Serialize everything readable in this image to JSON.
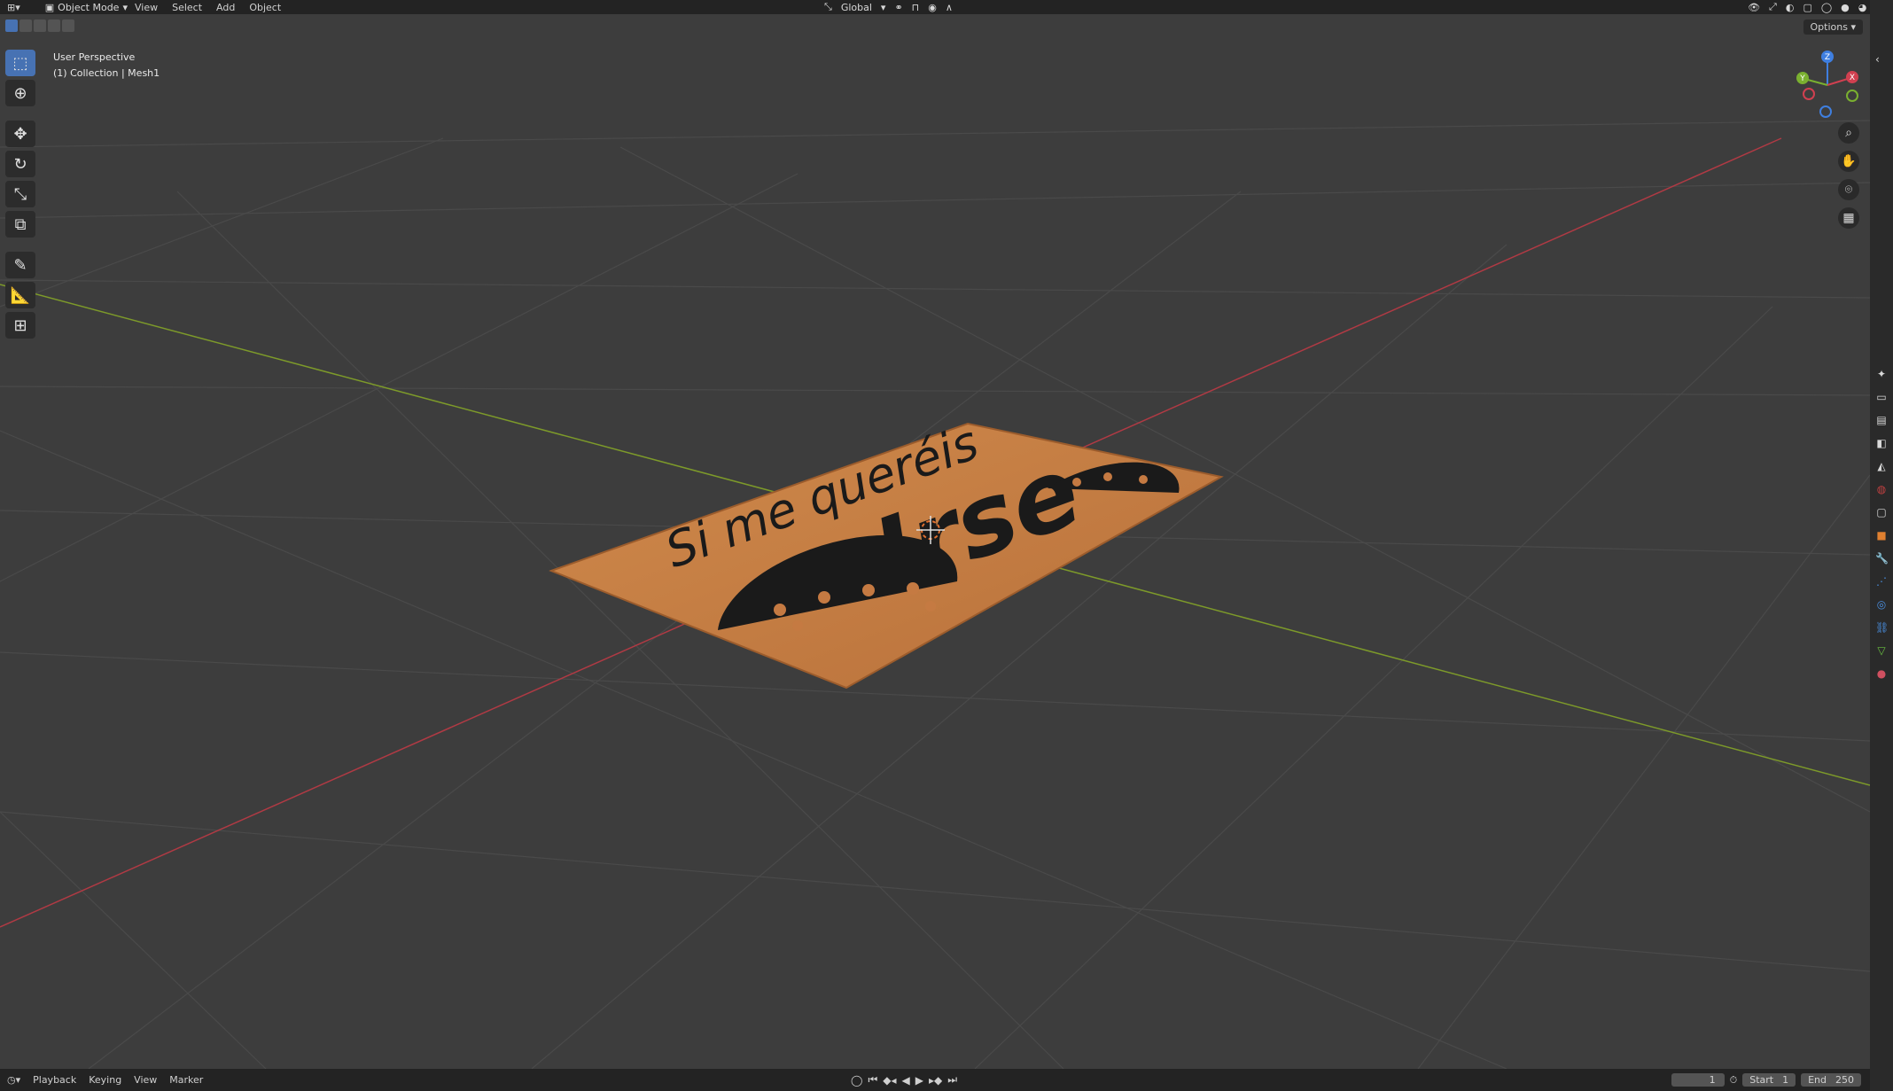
{
  "header": {
    "mode_label": "Object Mode",
    "menu": [
      "View",
      "Select",
      "Add",
      "Object"
    ],
    "orientation_label": "Global",
    "options_label": "Options"
  },
  "viewport": {
    "perspective_label": "User Perspective",
    "collection_label": "(1) Collection | Mesh1"
  },
  "gizmo": {
    "x": "X",
    "y": "Y",
    "z": "Z"
  },
  "mat": {
    "line1": "Si me queréis",
    "line2": "Irse"
  },
  "timeline": {
    "menu": [
      "Playback",
      "Keying",
      "View",
      "Marker"
    ],
    "current_frame": "1",
    "start_label": "Start",
    "start_value": "1",
    "end_label": "End",
    "end_value": "250"
  },
  "colors": {
    "background": "#3d3d3d",
    "grid": "#4a4a4a",
    "x_axis": "#b03a44",
    "y_axis": "#7d9a2a",
    "mat": "#c57a42",
    "accent": "#4772b3"
  }
}
